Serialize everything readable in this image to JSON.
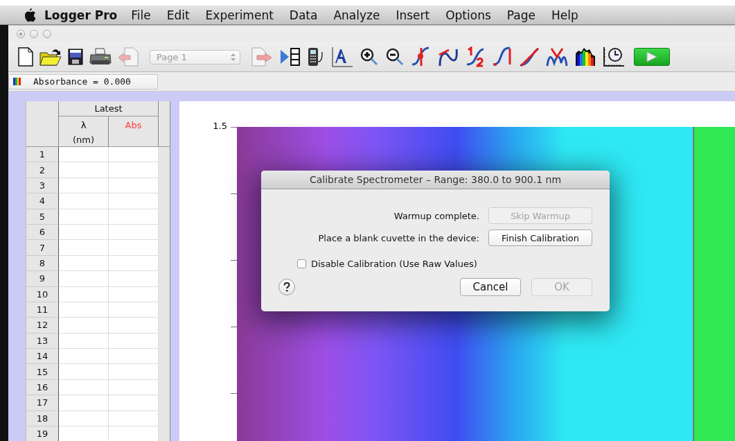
{
  "menu_bar": {
    "app_name": "Logger Pro",
    "items": [
      "File",
      "Edit",
      "Experiment",
      "Data",
      "Analyze",
      "Insert",
      "Options",
      "Page",
      "Help"
    ]
  },
  "toolbar": {
    "page_select": {
      "value": "Page 1",
      "disabled": true
    }
  },
  "meter": {
    "text": "Absorbance = 0.000"
  },
  "table": {
    "group_heading": "Latest",
    "columns": [
      {
        "symbol": "λ",
        "unit": "(nm)",
        "color": "#000000"
      },
      {
        "symbol": "Abs",
        "color": "#ff3b3b"
      }
    ],
    "row_numbers": [
      "1",
      "2",
      "3",
      "4",
      "5",
      "6",
      "7",
      "8",
      "9",
      "10",
      "11",
      "12",
      "13",
      "14",
      "15",
      "16",
      "17",
      "18",
      "19"
    ]
  },
  "graph": {
    "y_tick_label": "1.5"
  },
  "dialog": {
    "title": "Calibrate Spectrometer – Range: 380.0 to 900.1 nm",
    "rows": [
      {
        "label": "Warmup complete.",
        "button": "Skip Warmup",
        "disabled": true
      },
      {
        "label": "Place a blank cuvette in the device:",
        "button": "Finish Calibration",
        "disabled": false
      }
    ],
    "checkbox": {
      "label": "Disable Calibration (Use Raw Values)",
      "checked": false
    },
    "buttons": [
      {
        "label": "Cancel",
        "disabled": false
      },
      {
        "label": "OK",
        "disabled": true
      }
    ]
  }
}
